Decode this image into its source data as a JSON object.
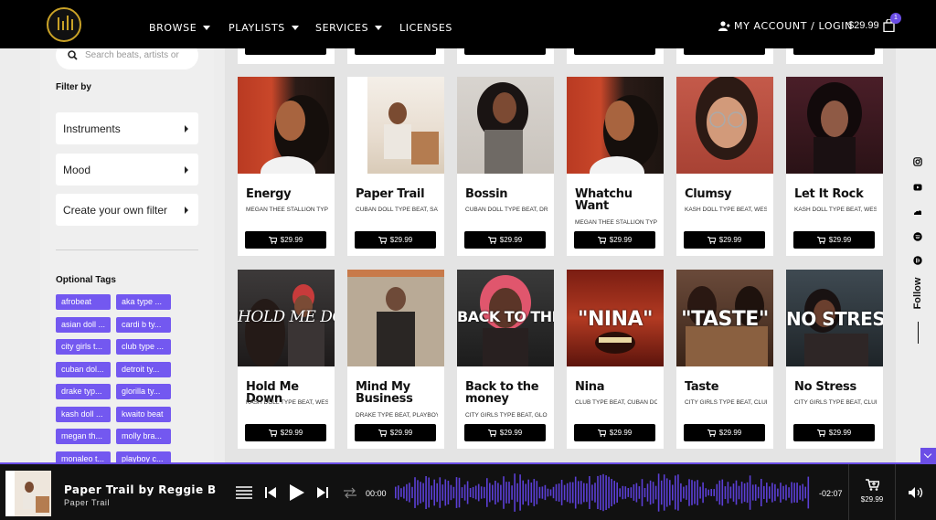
{
  "header": {
    "nav": [
      {
        "label": "BROWSE"
      },
      {
        "label": "PLAYLISTS"
      },
      {
        "label": "SERVICES"
      },
      {
        "label": "LICENSES"
      }
    ],
    "account_label": "MY ACCOUNT / LOGIN",
    "cart_total": "$29.99",
    "cart_count": "1"
  },
  "sidebar": {
    "search_placeholder": "Search beats, artists or",
    "filter_by": "Filter by",
    "filters": [
      {
        "label": "Instruments"
      },
      {
        "label": "Mood"
      },
      {
        "label": "Create your own filter"
      }
    ],
    "optional_tags_label": "Optional Tags",
    "tags": [
      "afrobeat",
      "aka type ...",
      "asian doll ...",
      "cardi b ty...",
      "city girls t...",
      "club type ...",
      "cuban dol...",
      "detroit ty...",
      "drake typ...",
      "glorilla ty...",
      "kash doll ...",
      "kwaito beat",
      "megan th...",
      "molly bra...",
      "monaleo t...",
      "playboy c..."
    ]
  },
  "beats": [
    {
      "title": "Energy",
      "subtitle": "MEGAN THEE STALLION TYPE BEAT",
      "price": "$29.99",
      "overlay": ""
    },
    {
      "title": "Paper Trail",
      "subtitle": "CUBAN DOLL TYPE BEAT, SAWEETIE",
      "price": "$29.99",
      "overlay": ""
    },
    {
      "title": "Bossin",
      "subtitle": "CUBAN DOLL TYPE BEAT, DRAKE",
      "price": "$29.99",
      "overlay": ""
    },
    {
      "title": "Whatchu Want",
      "subtitle": "MEGAN THEE STALLION TYPE BEAT",
      "price": "$29.99",
      "overlay": ""
    },
    {
      "title": "Clumsy",
      "subtitle": "KASH DOLL TYPE BEAT, WEST",
      "price": "$29.99",
      "overlay": ""
    },
    {
      "title": "Let It Rock",
      "subtitle": "KASH DOLL TYPE BEAT, WEST",
      "price": "$29.99",
      "overlay": ""
    },
    {
      "title": "Hold Me Down",
      "subtitle": "KASH DOLL TYPE BEAT, WEST",
      "price": "$29.99",
      "overlay": "HOLD ME DOWN"
    },
    {
      "title": "Mind My Business",
      "subtitle": "DRAKE TYPE BEAT, PLAYBOY",
      "price": "$29.99",
      "overlay": ""
    },
    {
      "title": "Back to the money",
      "subtitle": "CITY GIRLS TYPE BEAT, GLORILLA",
      "price": "$29.99",
      "overlay": "BACK TO THE MONEY"
    },
    {
      "title": "Nina",
      "subtitle": "CLUB TYPE BEAT, CUBAN DOLL",
      "price": "$29.99",
      "overlay": "\"NINA\""
    },
    {
      "title": "Taste",
      "subtitle": "CITY GIRLS TYPE BEAT, CLUB",
      "price": "$29.99",
      "overlay": "\"TASTE\""
    },
    {
      "title": "No Stress",
      "subtitle": "CITY GIRLS TYPE BEAT, CLUB",
      "price": "$29.99",
      "overlay": "NO STRESS"
    }
  ],
  "follow_label": "Follow",
  "player": {
    "title": "Paper Trail by Reggie B",
    "subtitle": "Paper Trail",
    "elapsed": "00:00",
    "remaining": "-02:07",
    "price": "$29.99"
  },
  "colors": {
    "accent": "#6b4ee6",
    "tag": "#7358f0",
    "gold": "#c9a227"
  },
  "icons": [
    "user-icon",
    "cart-icon",
    "search-icon",
    "instagram-icon",
    "youtube-icon",
    "soundcloud-icon",
    "spotify-icon",
    "beatstars-icon",
    "menu-icon",
    "previous-icon",
    "play-icon",
    "next-icon",
    "repeat-icon",
    "volume-icon"
  ]
}
